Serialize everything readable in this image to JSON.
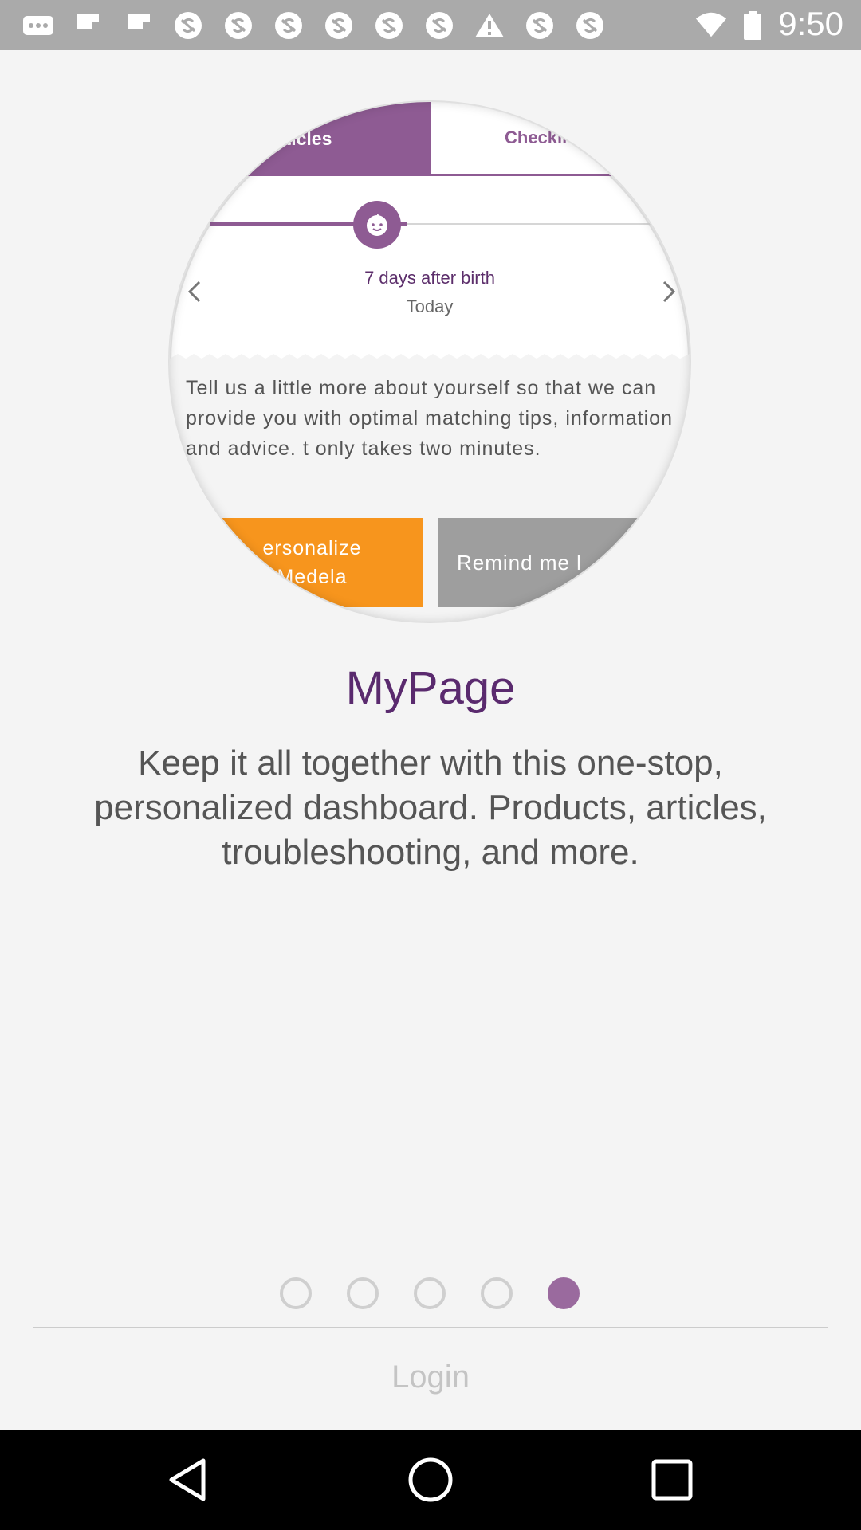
{
  "status_bar": {
    "time": "9:50",
    "icons": [
      "more-icon",
      "flipboard-icon",
      "flipboard-icon",
      "sync-disabled-icon",
      "sync-disabled-icon",
      "sync-disabled-icon",
      "sync-disabled-icon",
      "sync-disabled-icon",
      "sync-disabled-icon",
      "alert-icon",
      "sync-disabled-icon",
      "sync-disabled-icon"
    ]
  },
  "hero": {
    "tab_articles": "rticles",
    "tab_checklist": "Checkli",
    "days_label": "7 days after birth",
    "today_label": "Today",
    "tell_text": "Tell us a little more about yourself so that we can provide you with optimal matching tips, information and advice. t only takes two minutes.",
    "personalize_label": "ersonalize\nMedela",
    "remind_label": "Remind me l",
    "accent": "#8e5b93",
    "orange": "#f7951d"
  },
  "title": "MyPage",
  "description": "Keep it all together with this one-stop, personalized dashboard. Products, articles, troubleshooting, and more.",
  "pager": {
    "count": 5,
    "active_index": 4
  },
  "login_label": "Login",
  "nav": {
    "icons": [
      "back-icon",
      "home-icon",
      "recents-icon"
    ]
  }
}
